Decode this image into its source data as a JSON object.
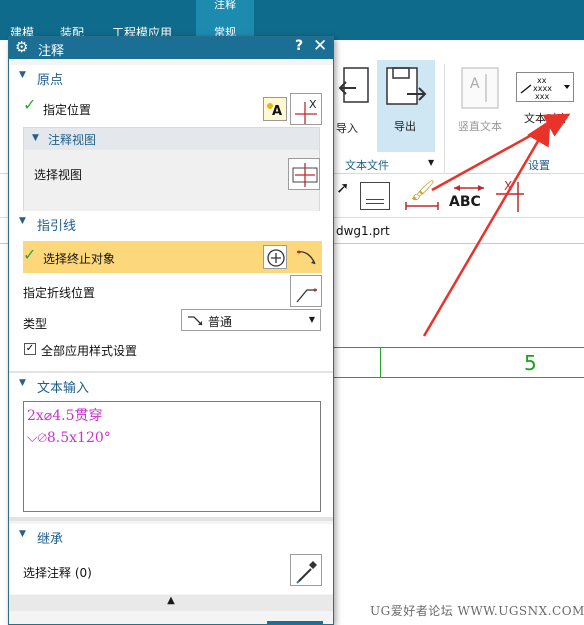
{
  "app": {
    "tabs": [
      "建模",
      "装配",
      "工程模应用"
    ],
    "active_tab": [
      "注释",
      "常规"
    ]
  },
  "ribbon": {
    "import_label": "导入",
    "export_label": "导出",
    "vertical_text_label": "竖直文本",
    "text_align_label": "文本对齐",
    "group_file": "文本文件",
    "group_settings": "设置",
    "abc_label": "ABC"
  },
  "file_tab": {
    "name": "dwg1.prt"
  },
  "canvas": {
    "number": "5"
  },
  "watermark": "UG爱好者论坛 WWW.UGSNX.COM",
  "dialog": {
    "title": "注释",
    "help": "?",
    "close": "✕",
    "origin": {
      "header": "原点",
      "specify_position": "指定位置",
      "view_header": "注释视图",
      "select_view": "选择视图"
    },
    "leader": {
      "header": "指引线",
      "select_end_object": "选择终止对象",
      "specify_jog_position": "指定折线位置",
      "type_label": "类型",
      "type_value": "普通",
      "apply_all_styles": "全部应用样式设置"
    },
    "text_input": {
      "header": "文本输入",
      "line1": "2x⌀4.5贯穿",
      "line2": "⌵⌀8.5x120°"
    },
    "inherit": {
      "header": "继承",
      "select_annotation": "选择注释 (0)"
    }
  },
  "colors": {
    "title_bar": "#1b6f95",
    "header_text": "#1f5f8b",
    "highlight": "#fcd87a",
    "annotation_text": "#cc33cc",
    "canvas_line": "#27a327",
    "arrow": "#e8322a"
  }
}
